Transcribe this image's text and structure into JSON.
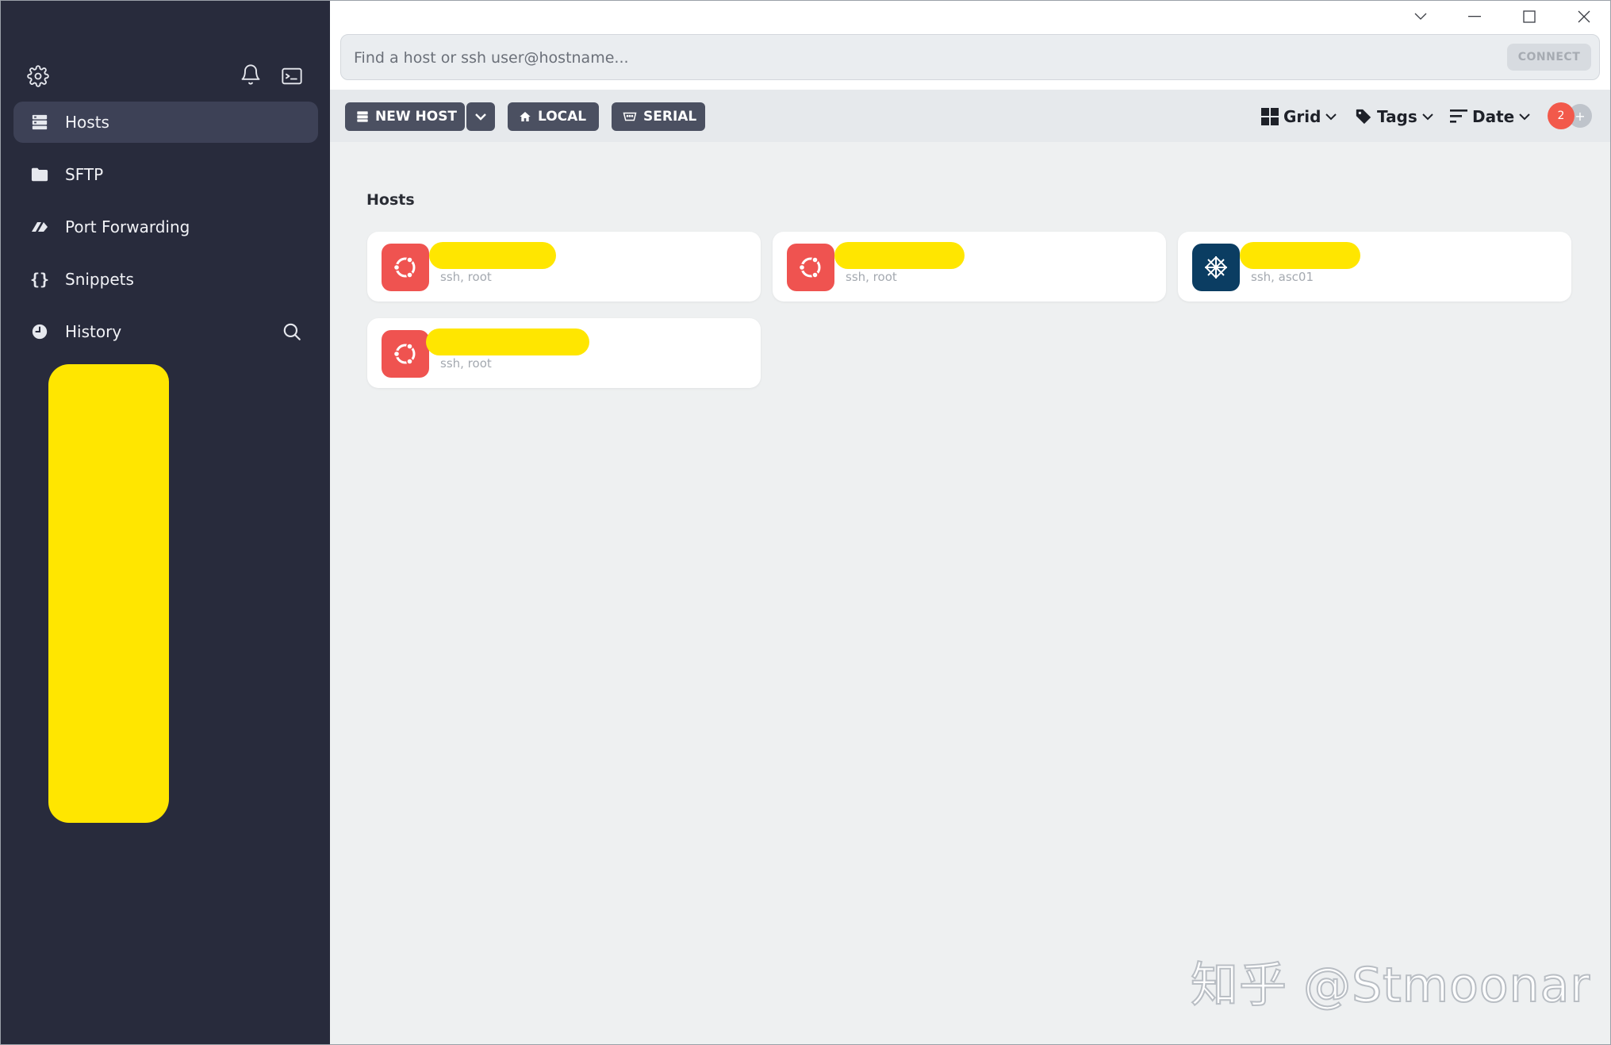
{
  "sidebar": {
    "nav": [
      {
        "label": "Hosts",
        "icon": "hosts-icon",
        "active": true
      },
      {
        "label": "SFTP",
        "icon": "folder-icon"
      },
      {
        "label": "Port Forwarding",
        "icon": "port-forwarding-icon"
      },
      {
        "label": "Snippets",
        "icon": "curly-braces-icon"
      },
      {
        "label": "History",
        "icon": "clock-icon"
      }
    ]
  },
  "search": {
    "placeholder": "Find a host or ssh user@hostname...",
    "connect_label": "CONNECT"
  },
  "toolbar": {
    "new_host_label": "NEW HOST",
    "local_label": "LOCAL",
    "serial_label": "SERIAL",
    "view_label": "Grid",
    "tags_label": "Tags",
    "sort_label": "Date",
    "badge_count": "2",
    "add_label": "+"
  },
  "content": {
    "section_title": "Hosts",
    "hosts": [
      {
        "subtitle": "ssh, root",
        "os": "ubuntu",
        "color": "#ef5350"
      },
      {
        "subtitle": "ssh, root",
        "os": "ubuntu",
        "color": "#ef5350"
      },
      {
        "subtitle": "ssh, asc01",
        "os": "centos",
        "color": "#0b3d62"
      },
      {
        "subtitle": "ssh, root",
        "os": "ubuntu",
        "color": "#ef5350"
      }
    ]
  },
  "watermark": "知乎 @Stmoonar",
  "colors": {
    "sidebar": "#282b3c",
    "accent_ubuntu": "#ef5350",
    "accent_centos": "#0b3d62",
    "redaction": "#ffe600"
  }
}
